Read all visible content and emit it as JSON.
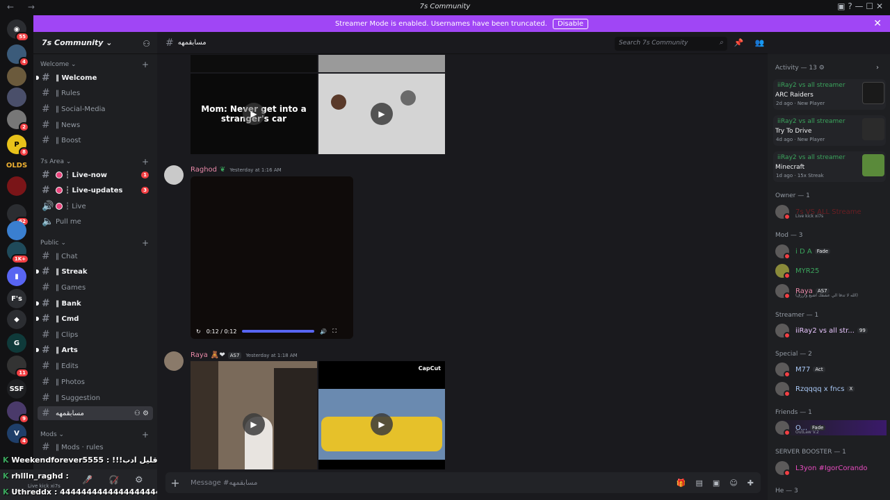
{
  "window": {
    "title": "7s Community",
    "nav_icons": "←  →",
    "right_icons": "▣  ?  —  ☐  ✕"
  },
  "banner": {
    "text": "Streamer Mode is enabled. Usernames have been truncated.",
    "disable_label": "Disable",
    "close": "✕"
  },
  "guild_badges": [
    "55",
    "4",
    "2",
    "8",
    "62",
    "1K+",
    "11",
    "9",
    "4"
  ],
  "guild_labels": {
    "olds": "OLDS",
    "fs": "F's",
    "ssf": "SSF"
  },
  "server": {
    "name": "7s Community ⌄"
  },
  "categories": [
    {
      "label": "Welcome ⌄"
    },
    {
      "label": "7s Area ⌄"
    },
    {
      "label": "Public ⌄"
    },
    {
      "label": "Mods ⌄"
    }
  ],
  "channels": [
    {
      "label": "‖ Welcome"
    },
    {
      "label": "‖ Rules"
    },
    {
      "label": "‖ Social-Media"
    },
    {
      "label": "‖ News"
    },
    {
      "label": "‖ Boost"
    },
    {
      "label": "┆ Live-now",
      "badge": "1"
    },
    {
      "label": "┆ Live-updates",
      "badge": "3"
    },
    {
      "label": "┆ Live"
    },
    {
      "label": "Pull me"
    },
    {
      "label": "‖ Chat"
    },
    {
      "label": "‖ Streak"
    },
    {
      "label": "‖ Games"
    },
    {
      "label": "‖ Bank"
    },
    {
      "label": "‖ Cmd"
    },
    {
      "label": "‖ Clips"
    },
    {
      "label": "‖ Arts"
    },
    {
      "label": "‖ Edits"
    },
    {
      "label": "‖ Photos"
    },
    {
      "label": "‖ Suggestion"
    },
    {
      "label": "مسابقمهه"
    },
    {
      "label": "‖ Mods · rules"
    }
  ],
  "overlay_chat": [
    {
      "text": "Weekendforever5555 : !!!حس صاير قليل ادب"
    },
    {
      "text": "rhllln_raghd :"
    },
    {
      "text": "Uthreddx : 4444444444444444444444444"
    }
  ],
  "user_panel": {
    "sub": "Live kick xi7s"
  },
  "channel_header": {
    "name": "مسابقمهه"
  },
  "search": {
    "placeholder": "Search 7s Community"
  },
  "messages": {
    "tile_caption": "Mom: Never get into a stranger's car",
    "raghod": {
      "author": "Raghod",
      "time": "Yesterday at 1:16 AM"
    },
    "video": {
      "time": "0:12 / 0:12"
    },
    "raya": {
      "author": "Raya",
      "tag": "AS7",
      "time": "Yesterday at 1:18 AM"
    },
    "capcut": "CapCut"
  },
  "composer": {
    "placeholder": "Message #مسابقمهه"
  },
  "members": {
    "activity_header": "Activity — 13",
    "activities": [
      {
        "title": "iiRay2 vs all streamer",
        "game": "ARC Raiders",
        "meta": "2d ago · New Player"
      },
      {
        "title": "iiRay2 vs all streamer",
        "game": "Try To Drive",
        "meta": "4d ago · New Player"
      },
      {
        "title": "iiRay2 vs all streamer",
        "game": "Minecraft",
        "meta": "1d ago · 15x Streak"
      }
    ],
    "sections": {
      "owner": "Owner — 1",
      "mod": "Mod — 3",
      "streamer": "Streamer — 1",
      "special": "Special — 2",
      "friends": "Friends — 1",
      "booster": "SERVER BOOSTER — 1",
      "he": "He — 3"
    },
    "rows": {
      "owner": {
        "name": "7s VS ALL Streame",
        "sub": "Live kick xi7s"
      },
      "ida": {
        "name": "i D A",
        "tag": "Fade"
      },
      "myr": {
        "name": "MYR25"
      },
      "raya": {
        "name": "Raya",
        "tag": "AS7",
        "sub": "(الله لا تدفا الي عشقك اشبع وارزق)"
      },
      "iiray": {
        "name": "iiRay2 vs all str...",
        "tag": "99"
      },
      "m77": {
        "name": "M77",
        "tag": "Act"
      },
      "rzq": {
        "name": "Rzqqqq x fncs",
        "tag": "X"
      },
      "o": {
        "name": "O...",
        "tag": "Fade",
        "sub": "OutLaw V.2"
      },
      "l3yon": {
        "name": "L3yon #IgorCorando"
      }
    }
  },
  "colors": {
    "accent": "#5865f2",
    "banner": "#a046f5",
    "online": "#3ba55d",
    "alert": "#f23f43"
  }
}
